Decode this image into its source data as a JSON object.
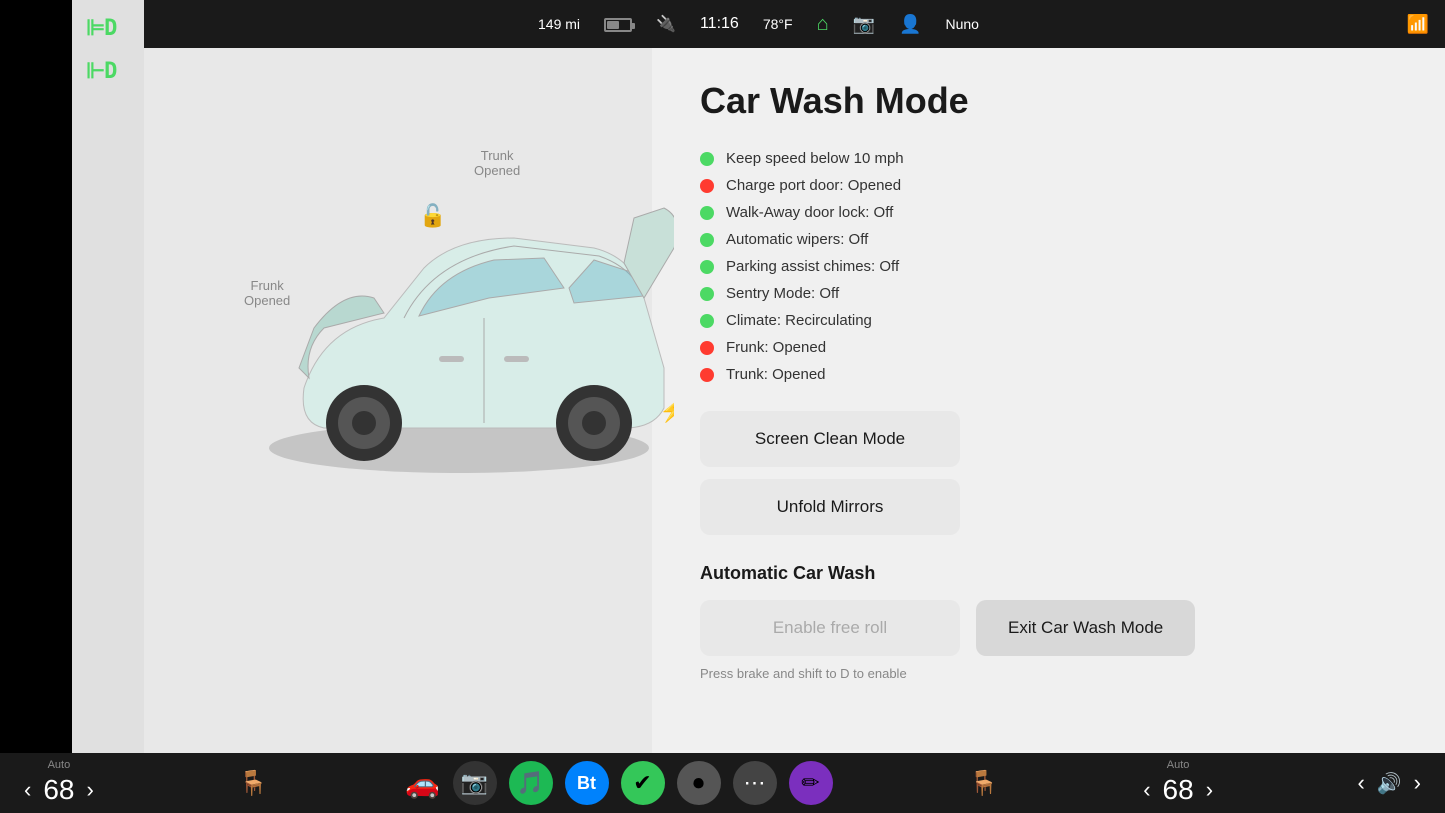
{
  "statusBar": {
    "range": "149 mi",
    "time": "11:16",
    "temperature": "78°F",
    "userName": "Nuno"
  },
  "sidebar": {
    "icon1": "⊫D",
    "icon2": "⊩D"
  },
  "carLabels": {
    "trunk": "Trunk",
    "trunkState": "Opened",
    "frunk": "Frunk",
    "frunkState": "Opened"
  },
  "page": {
    "title": "Car Wash Mode"
  },
  "statusItems": [
    {
      "label": "Keep speed below 10 mph",
      "status": "green"
    },
    {
      "label": "Charge port door: Opened",
      "status": "red"
    },
    {
      "label": "Walk-Away door lock: Off",
      "status": "green"
    },
    {
      "label": "Automatic wipers: Off",
      "status": "green"
    },
    {
      "label": "Parking assist chimes: Off",
      "status": "green"
    },
    {
      "label": "Sentry Mode: Off",
      "status": "green"
    },
    {
      "label": "Climate:  Recirculating",
      "status": "green"
    },
    {
      "label": "Frunk: Opened",
      "status": "red"
    },
    {
      "label": "Trunk: Opened",
      "status": "red"
    }
  ],
  "buttons": {
    "screenCleanMode": "Screen Clean Mode",
    "unfoldMirrors": "Unfold Mirrors",
    "enableFreeRoll": "Enable free roll",
    "exitCarWashMode": "Exit Car Wash Mode"
  },
  "sections": {
    "automaticCarWash": "Automatic Car Wash"
  },
  "hints": {
    "brakeNote": "Press brake and shift to D to enable"
  },
  "taskbar": {
    "leftTemp": "Auto",
    "leftNum": "68",
    "rightTemp": "Auto",
    "rightNum": "68",
    "apps": [
      {
        "name": "camera-app",
        "emoji": "📷",
        "bg": "#222"
      },
      {
        "name": "spotify-app",
        "emoji": "🎵",
        "bg": "#1DB954"
      },
      {
        "name": "bluetooth-app",
        "emoji": "⬡",
        "bg": "#0082FC"
      },
      {
        "name": "checklist-app",
        "emoji": "✔",
        "bg": "#34C759"
      },
      {
        "name": "camera2-app",
        "emoji": "⏺",
        "bg": "#333"
      },
      {
        "name": "dots-app",
        "emoji": "⋯",
        "bg": "#444"
      },
      {
        "name": "marker-app",
        "emoji": "✏",
        "bg": "#7B2FBE"
      }
    ]
  }
}
